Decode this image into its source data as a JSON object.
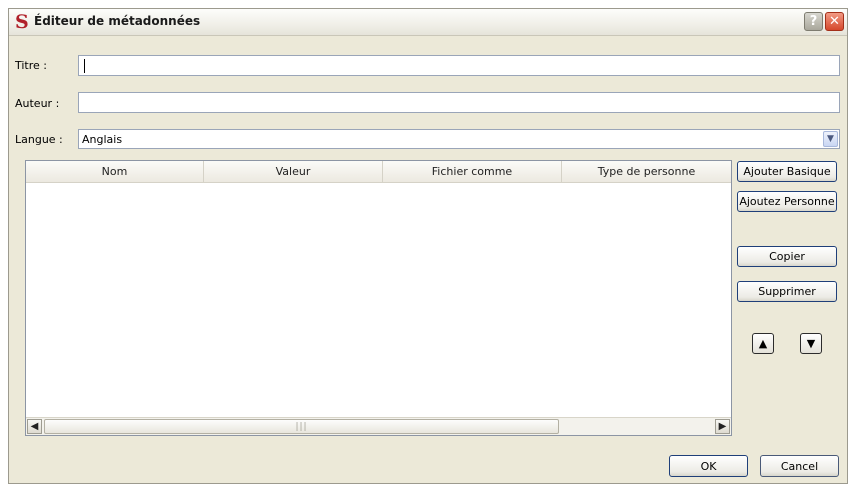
{
  "window": {
    "title": "Éditeur de métadonnées",
    "app_icon_glyph": "S",
    "help_glyph": "?",
    "close_glyph": "✕"
  },
  "form": {
    "title_label": "Titre :",
    "title_value": "",
    "author_label": "Auteur :",
    "author_value": "",
    "language_label": "Langue :",
    "language_value": "Anglais"
  },
  "table": {
    "columns": [
      "Nom",
      "Valeur",
      "Fichier comme",
      "Type de personne"
    ],
    "rows": [],
    "scroll_grip": "|||"
  },
  "side_buttons": {
    "add_basic": "Ajouter Basique",
    "add_person": "Ajoutez Personne",
    "copy": "Copier",
    "delete": "Supprimer"
  },
  "footer": {
    "ok": "OK",
    "cancel": "Cancel"
  },
  "icons": {
    "move_up": "triangle-up-icon",
    "move_down": "triangle-down-icon",
    "dropdown": "chevron-down-icon"
  }
}
